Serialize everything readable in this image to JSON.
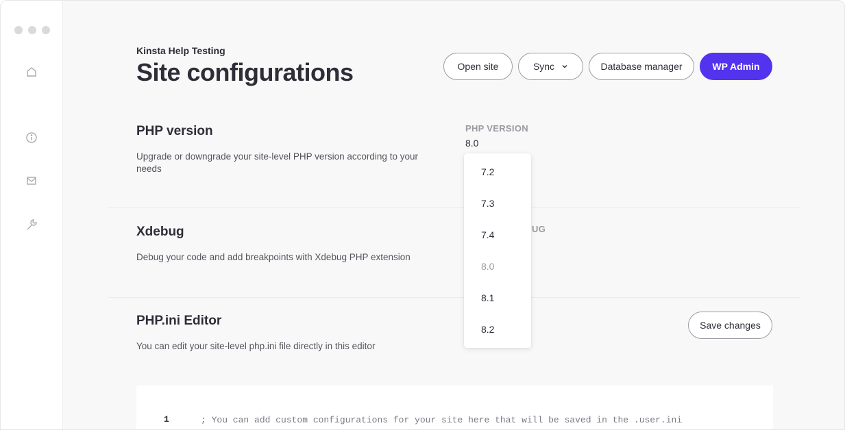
{
  "sidebar": {
    "items": [
      {
        "icon": "home-icon"
      },
      {
        "icon": "info-icon"
      },
      {
        "icon": "mail-icon"
      },
      {
        "icon": "wrench-icon"
      }
    ]
  },
  "header": {
    "site_name": "Kinsta Help Testing",
    "title": "Site configurations",
    "buttons": {
      "open_site": "Open site",
      "sync": "Sync",
      "database_manager": "Database manager",
      "wp_admin": "WP Admin"
    }
  },
  "php_version": {
    "title": "PHP version",
    "description": "Upgrade or downgrade your site-level PHP version according to your needs",
    "field_label": "PHP VERSION",
    "current_value": "8.0",
    "options": [
      "7.2",
      "7.3",
      "7.4",
      "8.0",
      "8.1",
      "8.2"
    ],
    "selected": "8.0"
  },
  "xdebug": {
    "title": "Xdebug",
    "description": "Debug your code and add breakpoints with Xdebug PHP extension",
    "field_label_visible": "UG"
  },
  "php_ini": {
    "title": "PHP.ini Editor",
    "description": "You can edit your site-level php.ini file directly in this editor",
    "save_label": "Save changes",
    "editor": {
      "line_number": "1",
      "line_text": "; You can add custom configurations for your site here that will be saved in the .user.ini"
    }
  },
  "colors": {
    "accent": "#5333ed",
    "text": "#2e2d38",
    "muted": "#9a9aa2",
    "background": "#f8f8f8"
  }
}
